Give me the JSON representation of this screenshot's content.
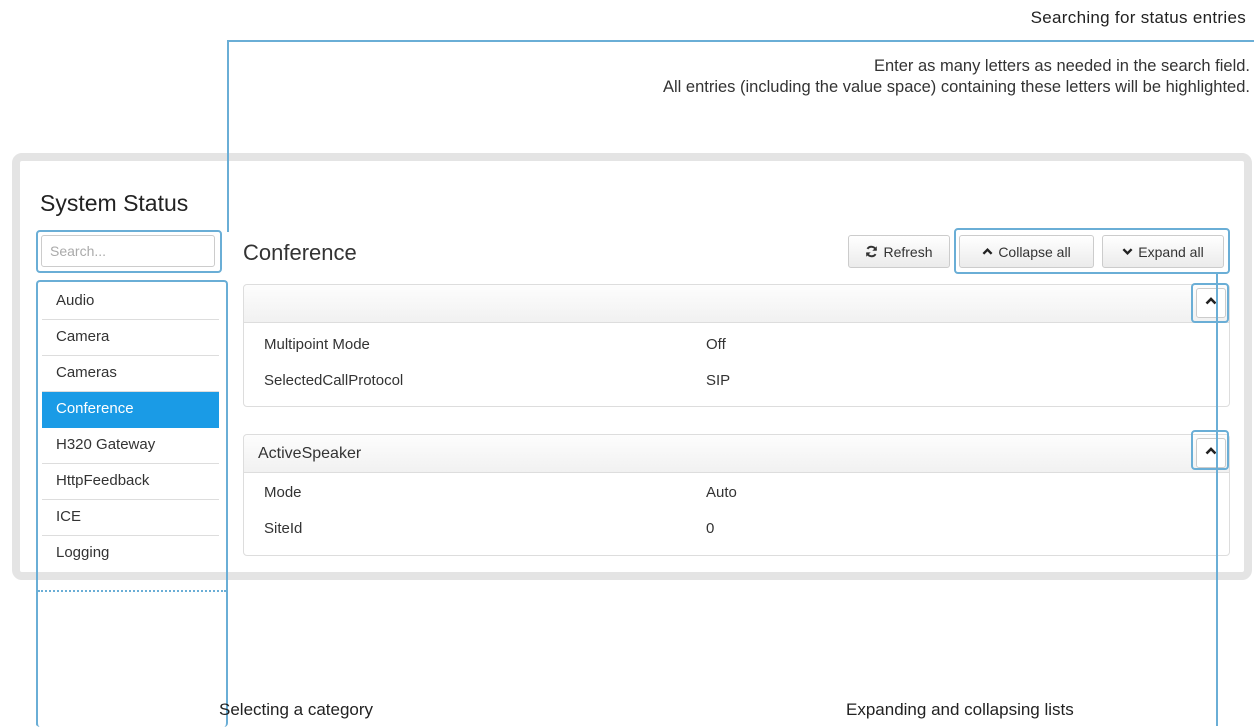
{
  "annotations": {
    "search_title": "Searching for status entries",
    "search_desc_line1": "Enter as many letters as needed in the search field.",
    "search_desc_line2": "All entries (including the value space) containing these letters will be highlighted.",
    "category_label": "Selecting a category",
    "expand_label": "Expanding and collapsing lists"
  },
  "sidebar": {
    "title": "System Status",
    "search_placeholder": "Search...",
    "items": [
      {
        "label": "Audio",
        "active": false
      },
      {
        "label": "Camera",
        "active": false
      },
      {
        "label": "Cameras",
        "active": false
      },
      {
        "label": "Conference",
        "active": true
      },
      {
        "label": "H320 Gateway",
        "active": false
      },
      {
        "label": "HttpFeedback",
        "active": false
      },
      {
        "label": "ICE",
        "active": false
      },
      {
        "label": "Logging",
        "active": false
      }
    ]
  },
  "main": {
    "title": "Conference",
    "refresh_label": "Refresh",
    "collapse_all_label": "Collapse all",
    "expand_all_label": "Expand all",
    "sections": [
      {
        "header": "",
        "rows": [
          {
            "key": "Multipoint Mode",
            "value": "Off"
          },
          {
            "key": "SelectedCallProtocol",
            "value": "SIP"
          }
        ]
      },
      {
        "header": "ActiveSpeaker",
        "rows": [
          {
            "key": "Mode",
            "value": "Auto"
          },
          {
            "key": "SiteId",
            "value": "0"
          }
        ]
      }
    ]
  },
  "colors": {
    "accent": "#1a9be6",
    "callout": "#6aaed6"
  }
}
